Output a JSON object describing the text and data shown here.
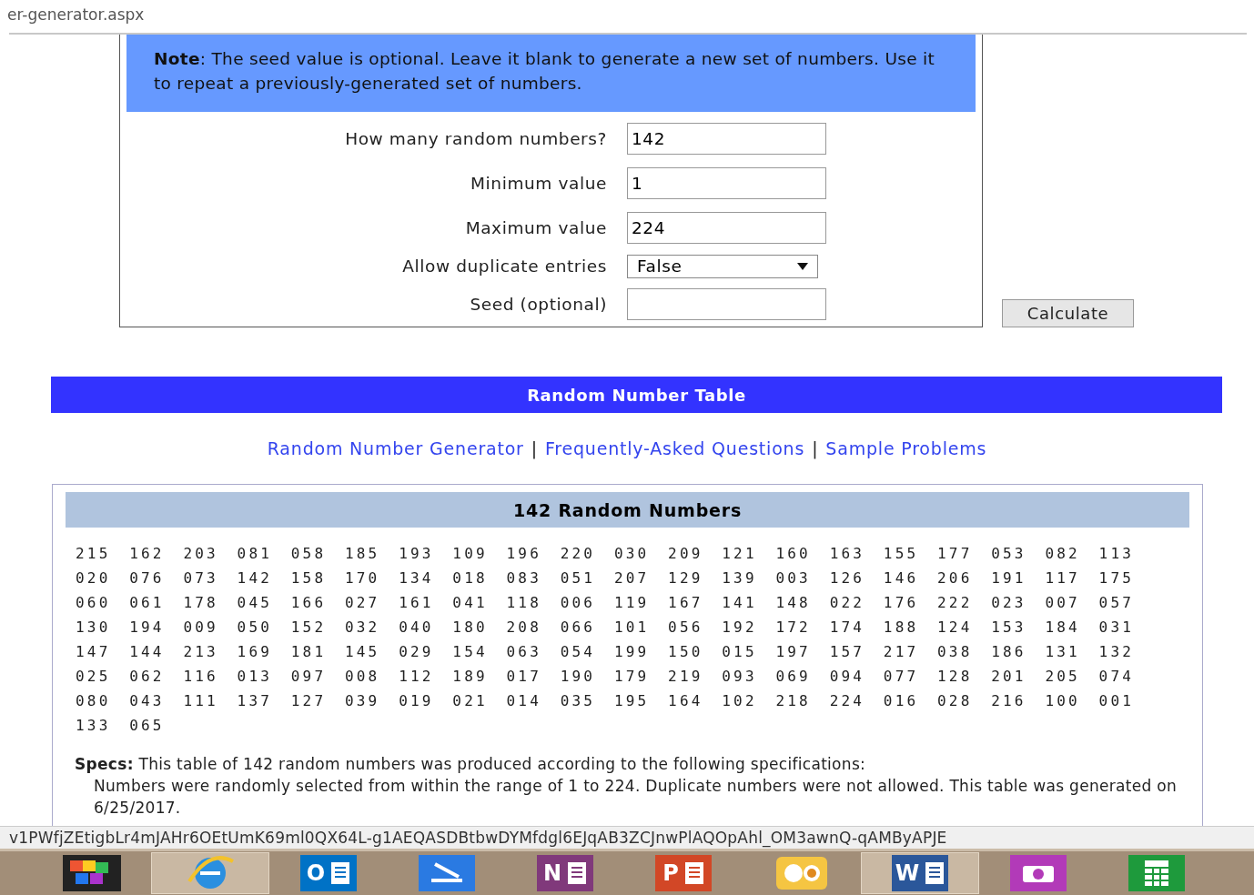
{
  "address_bar": {
    "url": "er-generator.aspx"
  },
  "note": {
    "label": "Note",
    "text": ": The seed value is optional. Leave it blank to generate a new set of numbers. Use it to repeat a previously-generated set of numbers."
  },
  "form": {
    "fields": [
      {
        "kind": "text",
        "label": "How many random numbers?",
        "value": "142"
      },
      {
        "kind": "text",
        "label": "Minimum value",
        "value": "1"
      },
      {
        "kind": "text",
        "label": "Maximum value",
        "value": "224"
      },
      {
        "kind": "select",
        "label": "Allow duplicate entries",
        "value": "False"
      },
      {
        "kind": "text",
        "label": "Seed (optional)"
      }
    ],
    "button": "Calculate"
  },
  "banner": {
    "title": "Random Number Table"
  },
  "links": [
    {
      "text": "Random Number Generator"
    },
    {
      "text": "|"
    },
    {
      "text": "Frequently-Asked Questions"
    },
    {
      "text": "|"
    },
    {
      "text": "Sample Problems"
    }
  ],
  "results": {
    "title": "142 Random Numbers",
    "numbers": [
      "215",
      "162",
      "203",
      "081",
      "058",
      "185",
      "193",
      "109",
      "196",
      "220",
      "030",
      "209",
      "121",
      "160",
      "163",
      "155",
      "177",
      "053",
      "082",
      "113",
      "020",
      "076",
      "073",
      "142",
      "158",
      "170",
      "134",
      "018",
      "083",
      "051",
      "207",
      "129",
      "139",
      "003",
      "126",
      "146",
      "206",
      "191",
      "117",
      "175",
      "060",
      "061",
      "178",
      "045",
      "166",
      "027",
      "161",
      "041",
      "118",
      "006",
      "119",
      "167",
      "141",
      "148",
      "022",
      "176",
      "222",
      "023",
      "007",
      "057",
      "130",
      "194",
      "009",
      "050",
      "152",
      "032",
      "040",
      "180",
      "208",
      "066",
      "101",
      "056",
      "192",
      "172",
      "174",
      "188",
      "124",
      "153",
      "184",
      "031",
      "147",
      "144",
      "213",
      "169",
      "181",
      "145",
      "029",
      "154",
      "063",
      "054",
      "199",
      "150",
      "015",
      "197",
      "157",
      "217",
      "038",
      "186",
      "131",
      "132",
      "025",
      "062",
      "116",
      "013",
      "097",
      "008",
      "112",
      "189",
      "017",
      "190",
      "179",
      "219",
      "093",
      "069",
      "094",
      "077",
      "128",
      "201",
      "205",
      "074",
      "080",
      "043",
      "111",
      "137",
      "127",
      "039",
      "019",
      "021",
      "014",
      "035",
      "195",
      "164",
      "102",
      "218",
      "224",
      "016",
      "028",
      "216",
      "100",
      "001",
      "133",
      "065"
    ],
    "specs_label": "Specs:",
    "specs_text": " This table of 142 random numbers was produced according to the following specifications:",
    "specs_detail": "Numbers were randomly selected from within the range of 1 to 224. Duplicate numbers were not allowed. This table was generated on 6/25/2017."
  },
  "status_bar": {
    "url": "v1PWfjZEtigbLr4mJAHr6OEtUmK69ml0QX64L-g1AEQASDBtbwDYMfdgl6EJqAB3ZCJnwPlAQOpAhl_OM3awnQ-qAMByAPJE"
  },
  "taskbar": {
    "items": [
      {
        "kind": "puzzle",
        "selected": false
      },
      {
        "kind": "browser",
        "selected": true
      },
      {
        "kind": "letter",
        "label": "O",
        "color": "#0072c6",
        "selected": false
      },
      {
        "kind": "scanner",
        "selected": false
      },
      {
        "kind": "letter",
        "label": "N",
        "color": "#80397b",
        "selected": false
      },
      {
        "kind": "letter",
        "label": "P",
        "color": "#d24726",
        "selected": false
      },
      {
        "kind": "calendar",
        "selected": false
      },
      {
        "kind": "letter",
        "label": "W",
        "color": "#2b579a",
        "selected": true
      },
      {
        "kind": "camera",
        "selected": false
      },
      {
        "kind": "calculator",
        "selected": false
      }
    ]
  }
}
